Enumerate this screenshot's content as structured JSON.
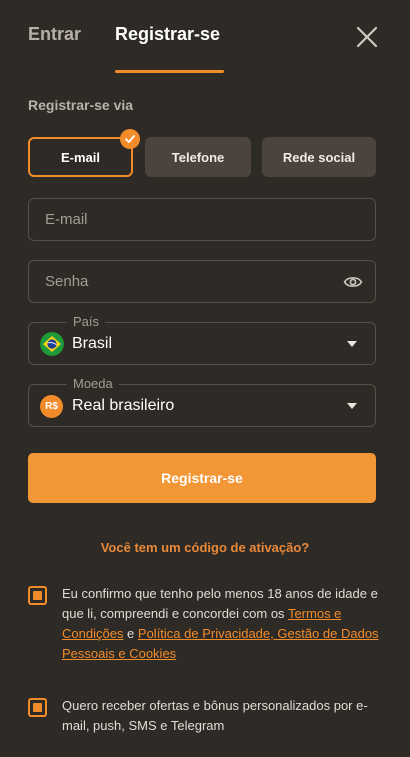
{
  "tabs": {
    "login": "Entrar",
    "register": "Registrar-se"
  },
  "register_via": {
    "label": "Registrar-se via",
    "methods": [
      {
        "label": "E-mail",
        "selected": true
      },
      {
        "label": "Telefone",
        "selected": false
      },
      {
        "label": "Rede social",
        "selected": false
      }
    ]
  },
  "form": {
    "email_placeholder": "E-mail",
    "password_placeholder": "Senha",
    "country": {
      "label": "País",
      "value": "Brasil"
    },
    "currency": {
      "label": "Moeda",
      "value": "Real brasileiro",
      "symbol": "R$"
    },
    "submit_label": "Registrar-se"
  },
  "activation_link": "Você tem um código de ativação?",
  "consents": {
    "terms": {
      "checked": true,
      "text_before": "Eu confirmo que tenho pelo menos 18 anos de idade e que li, compreendi e concordei com os ",
      "link_terms": "Termos e Condições",
      "conjunction": " e ",
      "link_privacy": "Política de Privacidade, Gestão de Dados Pessoais e Cookies"
    },
    "offers": {
      "checked": true,
      "text": "Quero receber ofertas e bônus personalizados por e-mail, push, SMS e Telegram"
    }
  },
  "colors": {
    "accent": "#f28c2b",
    "background": "#2e2a26",
    "secondary_button": "#4b433c"
  },
  "icons": {
    "close": "close-icon",
    "check": "check-icon",
    "eye": "eye-icon",
    "flag": "brazil-flag-icon",
    "currency": "currency-coin-icon",
    "caret": "chevron-down-icon"
  }
}
